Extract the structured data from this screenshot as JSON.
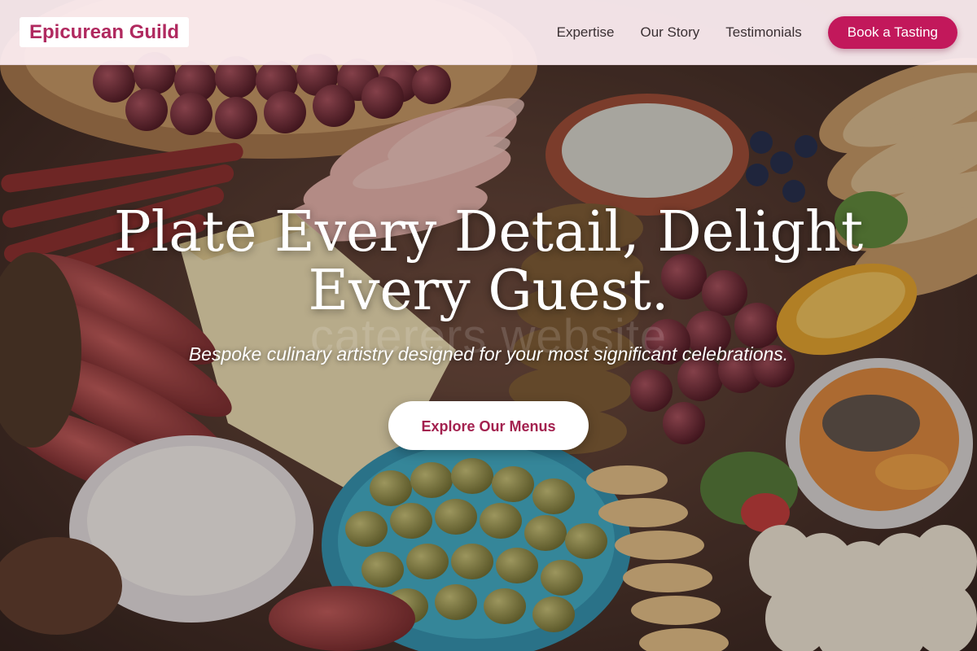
{
  "header": {
    "logo": "Epicurean Guild",
    "nav": [
      {
        "label": "Expertise"
      },
      {
        "label": "Our Story"
      },
      {
        "label": "Testimonials"
      }
    ],
    "cta_label": "Book a Tasting"
  },
  "hero": {
    "title": "Plate Every Detail, Delight Every Guest.",
    "subtitle": "Bespoke culinary artistry designed for your most significant celebrations.",
    "cta_label": "Explore Our Menus",
    "watermark": "caterers website",
    "background": "charcuterie-board-photo"
  },
  "colors": {
    "brand": "#c2185b",
    "logo_text": "#b0295f",
    "cta_text": "#a3214f",
    "header_bg": "#fff0f4"
  }
}
